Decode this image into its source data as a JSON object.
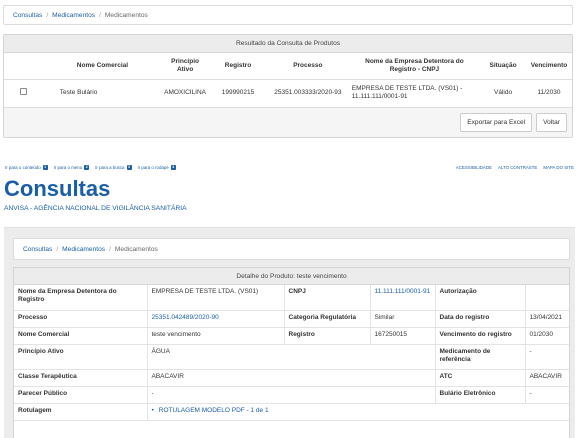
{
  "top": {
    "breadcrumb": {
      "item1": "Consultas",
      "item2": "Medicamentos",
      "current": "Medicamentos",
      "separator": "/"
    },
    "results": {
      "title": "Resultado da Consulta de Produtos",
      "columns": {
        "nome_comercial": "Nome Comercial",
        "principio_ativo": "Princípio Ativo",
        "registro": "Registro",
        "processo": "Processo",
        "empresa": "Nome da Empresa Detentora do Registro - CNPJ",
        "situacao": "Situação",
        "vencimento": "Vencimento"
      },
      "row": {
        "nome_comercial": "Teste Bulário",
        "principio_ativo": "AMOXICILINA",
        "registro": "199990215",
        "processo": "25351.003333/2020-93",
        "empresa": "EMPRESA DE TESTE LTDA. (VS01) - 11.111.111/0001-91",
        "situacao": "Válido",
        "vencimento": "11/2030"
      }
    },
    "buttons": {
      "export": "Exportar para Excel",
      "back": "Voltar"
    }
  },
  "accessibility": {
    "links": [
      {
        "label": "Ir para o conteúdo",
        "key": "1"
      },
      {
        "label": "Ir para o menu",
        "key": "2"
      },
      {
        "label": "Ir para a busca",
        "key": "3"
      },
      {
        "label": "Ir para o rodapé",
        "key": "4"
      }
    ],
    "right": {
      "acessibilidade": "ACESSIBILIDADE",
      "contraste": "ALTO CONTRASTE",
      "mapa": "MAPA DO SITE"
    }
  },
  "header": {
    "title": "Consultas",
    "subtitle": "ANVISA - AGÊNCIA NACIONAL DE VIGILÂNCIA SANITÁRIA"
  },
  "bottom": {
    "breadcrumb": {
      "item1": "Consultas",
      "item2": "Medicamentos",
      "current": "Medicamentos",
      "separator": "/"
    },
    "detail": {
      "title": "Detalhe do Produto: teste vencimento",
      "labels": {
        "empresa": "Nome da Empresa Detentora do Registro",
        "cnpj": "CNPJ",
        "autorizacao": "Autorização",
        "processo": "Processo",
        "categoria": "Categoria Regulatória",
        "data_registro": "Data do registro",
        "nome_comercial": "Nome Comercial",
        "registro": "Registro",
        "vencimento_registro": "Vencimento do registro",
        "principio_ativo": "Princípio Ativo",
        "medicamento_referencia": "Medicamento de referência",
        "classe": "Classe Terapêutica",
        "atc": "ATC",
        "parecer": "Parecer Público",
        "bulario": "Bulário Eletrônico",
        "rotulagem": "Rotulagem"
      },
      "values": {
        "empresa": "EMPRESA DE TESTE LTDA. (VS01)",
        "cnpj": "11.111.111/0001-91",
        "autorizacao": "",
        "processo": "25351.042489/2020-90",
        "categoria": "Similar",
        "data_registro": "13/04/2021",
        "nome_comercial": "teste vencimento",
        "registro": "167250015",
        "vencimento_registro": "01/2030",
        "principio_ativo": "ÁGUA",
        "medicamento_referencia": "-",
        "classe": "ABACAVIR",
        "atc": "ABACAVIR",
        "parecer": "-",
        "bulario": "-",
        "rotulagem": "ROTULAGEM MODELO PDF - 1 de 1"
      }
    }
  }
}
